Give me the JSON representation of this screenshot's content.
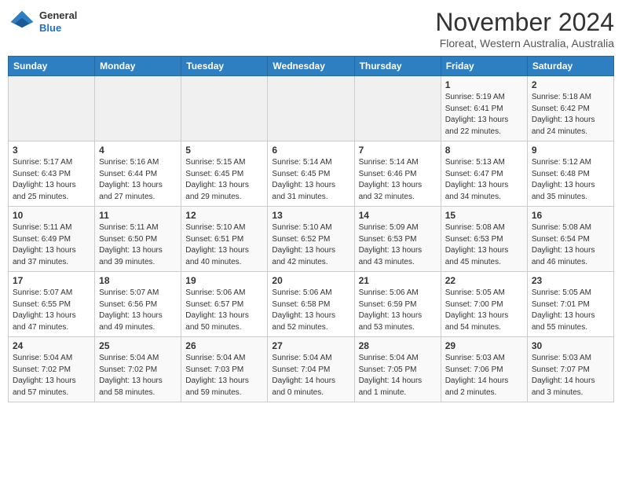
{
  "header": {
    "logo_general": "General",
    "logo_blue": "Blue",
    "month": "November 2024",
    "location": "Floreat, Western Australia, Australia"
  },
  "days_of_week": [
    "Sunday",
    "Monday",
    "Tuesday",
    "Wednesday",
    "Thursday",
    "Friday",
    "Saturday"
  ],
  "weeks": [
    [
      {
        "day": "",
        "info": ""
      },
      {
        "day": "",
        "info": ""
      },
      {
        "day": "",
        "info": ""
      },
      {
        "day": "",
        "info": ""
      },
      {
        "day": "",
        "info": ""
      },
      {
        "day": "1",
        "info": "Sunrise: 5:19 AM\nSunset: 6:41 PM\nDaylight: 13 hours\nand 22 minutes."
      },
      {
        "day": "2",
        "info": "Sunrise: 5:18 AM\nSunset: 6:42 PM\nDaylight: 13 hours\nand 24 minutes."
      }
    ],
    [
      {
        "day": "3",
        "info": "Sunrise: 5:17 AM\nSunset: 6:43 PM\nDaylight: 13 hours\nand 25 minutes."
      },
      {
        "day": "4",
        "info": "Sunrise: 5:16 AM\nSunset: 6:44 PM\nDaylight: 13 hours\nand 27 minutes."
      },
      {
        "day": "5",
        "info": "Sunrise: 5:15 AM\nSunset: 6:45 PM\nDaylight: 13 hours\nand 29 minutes."
      },
      {
        "day": "6",
        "info": "Sunrise: 5:14 AM\nSunset: 6:45 PM\nDaylight: 13 hours\nand 31 minutes."
      },
      {
        "day": "7",
        "info": "Sunrise: 5:14 AM\nSunset: 6:46 PM\nDaylight: 13 hours\nand 32 minutes."
      },
      {
        "day": "8",
        "info": "Sunrise: 5:13 AM\nSunset: 6:47 PM\nDaylight: 13 hours\nand 34 minutes."
      },
      {
        "day": "9",
        "info": "Sunrise: 5:12 AM\nSunset: 6:48 PM\nDaylight: 13 hours\nand 35 minutes."
      }
    ],
    [
      {
        "day": "10",
        "info": "Sunrise: 5:11 AM\nSunset: 6:49 PM\nDaylight: 13 hours\nand 37 minutes."
      },
      {
        "day": "11",
        "info": "Sunrise: 5:11 AM\nSunset: 6:50 PM\nDaylight: 13 hours\nand 39 minutes."
      },
      {
        "day": "12",
        "info": "Sunrise: 5:10 AM\nSunset: 6:51 PM\nDaylight: 13 hours\nand 40 minutes."
      },
      {
        "day": "13",
        "info": "Sunrise: 5:10 AM\nSunset: 6:52 PM\nDaylight: 13 hours\nand 42 minutes."
      },
      {
        "day": "14",
        "info": "Sunrise: 5:09 AM\nSunset: 6:53 PM\nDaylight: 13 hours\nand 43 minutes."
      },
      {
        "day": "15",
        "info": "Sunrise: 5:08 AM\nSunset: 6:53 PM\nDaylight: 13 hours\nand 45 minutes."
      },
      {
        "day": "16",
        "info": "Sunrise: 5:08 AM\nSunset: 6:54 PM\nDaylight: 13 hours\nand 46 minutes."
      }
    ],
    [
      {
        "day": "17",
        "info": "Sunrise: 5:07 AM\nSunset: 6:55 PM\nDaylight: 13 hours\nand 47 minutes."
      },
      {
        "day": "18",
        "info": "Sunrise: 5:07 AM\nSunset: 6:56 PM\nDaylight: 13 hours\nand 49 minutes."
      },
      {
        "day": "19",
        "info": "Sunrise: 5:06 AM\nSunset: 6:57 PM\nDaylight: 13 hours\nand 50 minutes."
      },
      {
        "day": "20",
        "info": "Sunrise: 5:06 AM\nSunset: 6:58 PM\nDaylight: 13 hours\nand 52 minutes."
      },
      {
        "day": "21",
        "info": "Sunrise: 5:06 AM\nSunset: 6:59 PM\nDaylight: 13 hours\nand 53 minutes."
      },
      {
        "day": "22",
        "info": "Sunrise: 5:05 AM\nSunset: 7:00 PM\nDaylight: 13 hours\nand 54 minutes."
      },
      {
        "day": "23",
        "info": "Sunrise: 5:05 AM\nSunset: 7:01 PM\nDaylight: 13 hours\nand 55 minutes."
      }
    ],
    [
      {
        "day": "24",
        "info": "Sunrise: 5:04 AM\nSunset: 7:02 PM\nDaylight: 13 hours\nand 57 minutes."
      },
      {
        "day": "25",
        "info": "Sunrise: 5:04 AM\nSunset: 7:02 PM\nDaylight: 13 hours\nand 58 minutes."
      },
      {
        "day": "26",
        "info": "Sunrise: 5:04 AM\nSunset: 7:03 PM\nDaylight: 13 hours\nand 59 minutes."
      },
      {
        "day": "27",
        "info": "Sunrise: 5:04 AM\nSunset: 7:04 PM\nDaylight: 14 hours\nand 0 minutes."
      },
      {
        "day": "28",
        "info": "Sunrise: 5:04 AM\nSunset: 7:05 PM\nDaylight: 14 hours\nand 1 minute."
      },
      {
        "day": "29",
        "info": "Sunrise: 5:03 AM\nSunset: 7:06 PM\nDaylight: 14 hours\nand 2 minutes."
      },
      {
        "day": "30",
        "info": "Sunrise: 5:03 AM\nSunset: 7:07 PM\nDaylight: 14 hours\nand 3 minutes."
      }
    ]
  ]
}
